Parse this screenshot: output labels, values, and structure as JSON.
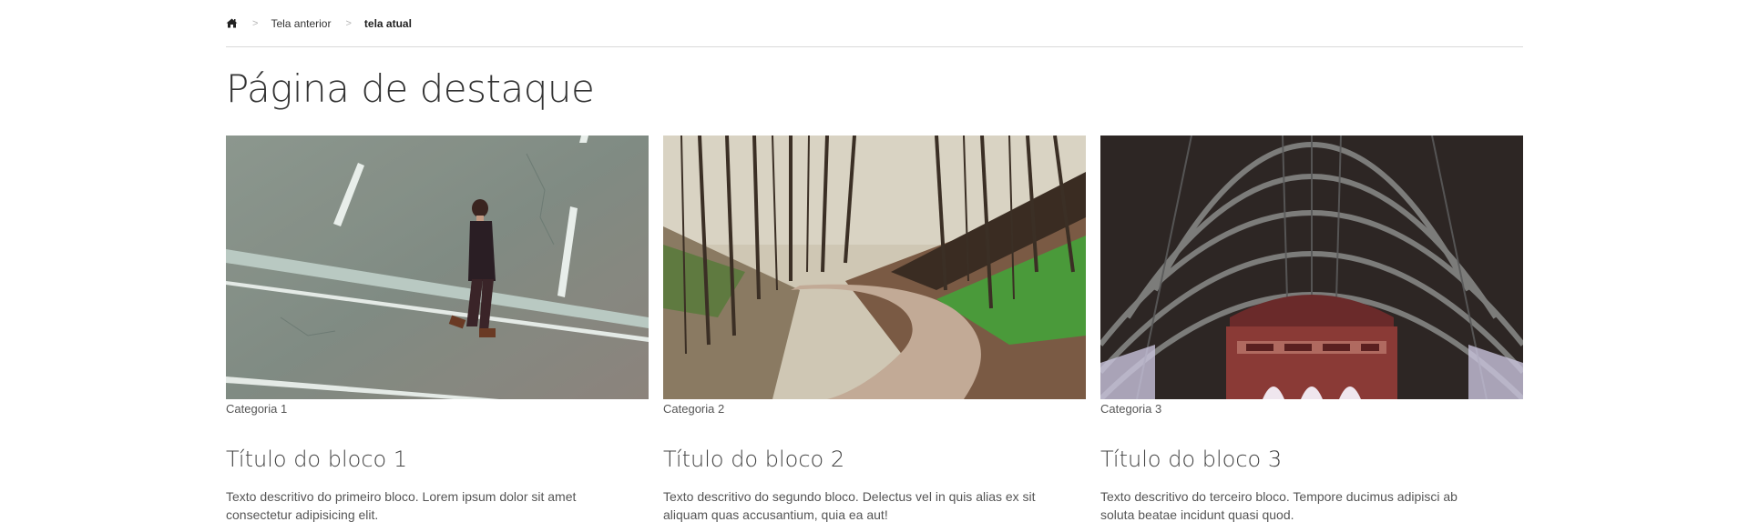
{
  "breadcrumb": {
    "home_icon": "home-icon",
    "previous": "Tela anterior",
    "current": "tela atual"
  },
  "page": {
    "title": "Página de destaque"
  },
  "cards": [
    {
      "image": "person-crossing-street-image",
      "category": "Categoria 1",
      "title": "Título do bloco 1",
      "description": "Texto descritivo do primeiro bloco. Lorem ipsum dolor sit amet consectetur adipisicing elit."
    },
    {
      "image": "forest-dirt-road-image",
      "category": "Categoria 2",
      "title": "Título do bloco 2",
      "description": "Texto descritivo do segundo bloco. Delectus vel in quis alias ex sit aliquam quas accusantium, quia ea aut!"
    },
    {
      "image": "station-roof-arch-image",
      "category": "Categoria 3",
      "title": "Título do bloco 3",
      "description": "Texto descritivo do terceiro bloco. Tempore ducimus adipisci ab soluta beatae incidunt quasi quod."
    }
  ]
}
